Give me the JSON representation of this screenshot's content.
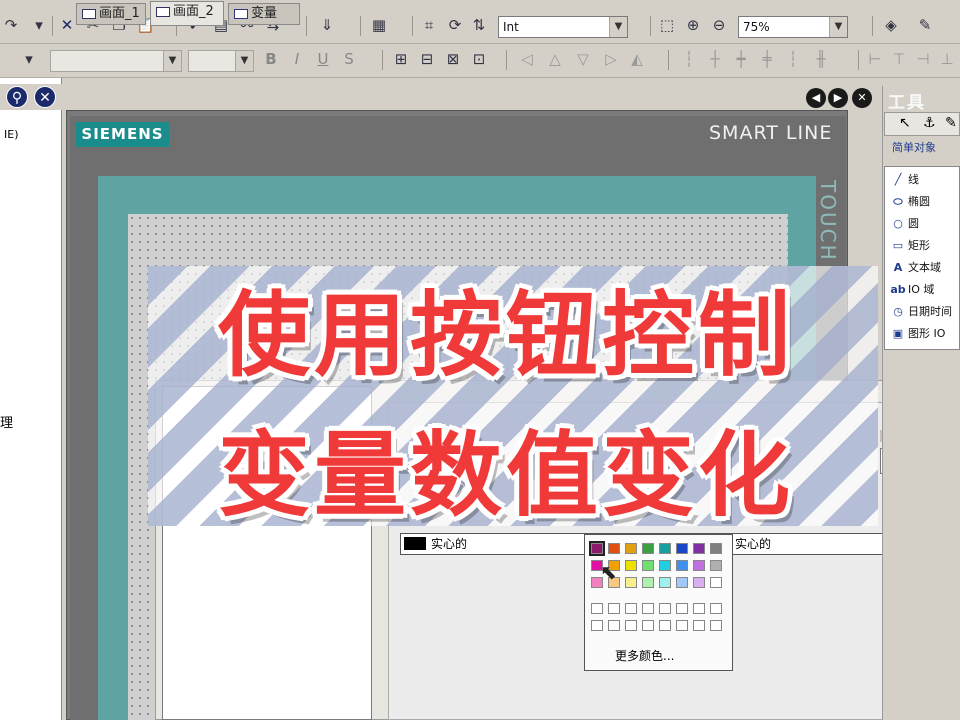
{
  "toolbar": {
    "zoom_value": "75%",
    "type_value": "Int"
  },
  "left_panel": {
    "item1": "IE)",
    "item2": "理"
  },
  "tabs": [
    {
      "label": "画面_1"
    },
    {
      "label": "画面_2"
    },
    {
      "label": "变量"
    }
  ],
  "screen": {
    "brand": "SIEMENS",
    "model": "SMART LINE",
    "side_label": "TOUCH"
  },
  "tools": {
    "title": "工具",
    "section": "简单对象",
    "items": [
      {
        "icon": "line-icon",
        "glyph": "╱",
        "label": "线"
      },
      {
        "icon": "ellipse-icon",
        "glyph": "⬭",
        "label": "椭圆"
      },
      {
        "icon": "circle-icon",
        "glyph": "○",
        "label": "圆"
      },
      {
        "icon": "rectangle-icon",
        "glyph": "▭",
        "label": "矩形"
      },
      {
        "icon": "text-field-icon",
        "glyph": "A",
        "label": "文本域"
      },
      {
        "icon": "io-field-icon",
        "glyph": "ab",
        "label": "IO 域"
      },
      {
        "icon": "date-time-icon",
        "glyph": "◷",
        "label": "日期时间"
      },
      {
        "icon": "graphic-io-icon",
        "glyph": "▣",
        "label": "图形 IO"
      }
    ]
  },
  "dialog": {
    "fill_label": "实心的",
    "style_label": "实心的",
    "more_colors": "更多颜色..."
  },
  "overlay": {
    "line1": "使用按钮控制",
    "line2": "变量数值变化"
  },
  "palette": {
    "row1": [
      "#8b1a6b",
      "#e05010",
      "#e0a010",
      "#3aa040",
      "#18a0a0",
      "#1848c8",
      "#8030a0",
      "#808080"
    ],
    "row2": [
      "#e010a0",
      "#f0a000",
      "#f0e000",
      "#70e070",
      "#20d0e0",
      "#4090f0",
      "#c070e0",
      "#b0b0b0"
    ],
    "row3": [
      "#f080c0",
      "#f8c880",
      "#f8f090",
      "#b0f0b0",
      "#a0f0f0",
      "#a0c8f8",
      "#d8b0f0",
      "#ffffff"
    ]
  }
}
